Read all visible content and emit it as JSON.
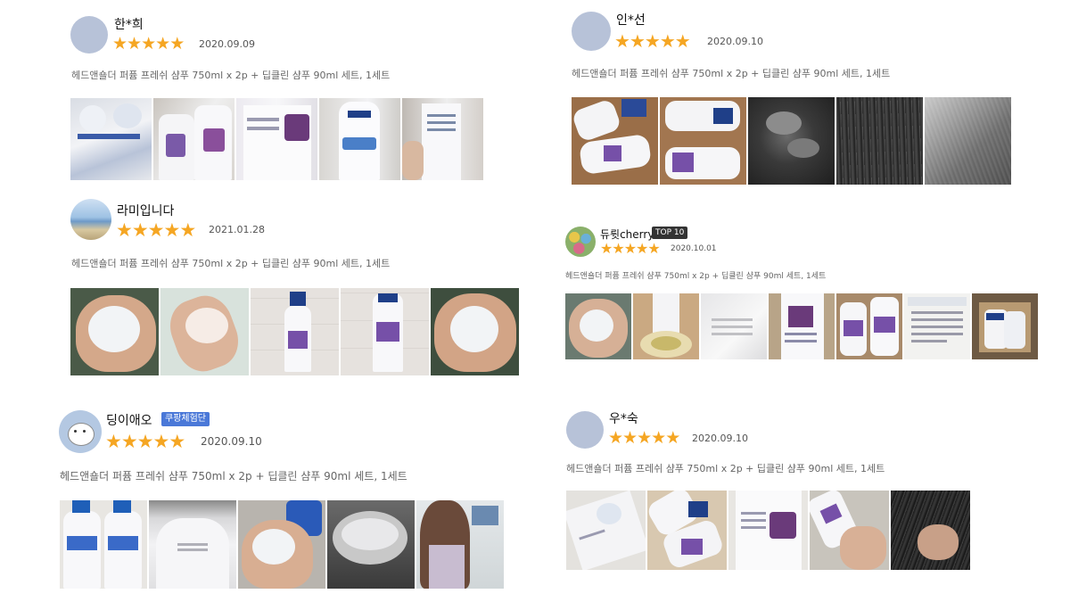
{
  "product_line": "헤드앤숄더 퍼퓸 프레쉬 샴푸 750ml x 2p + 딥클린 샴푸 90ml 세트, 1세트",
  "star_glyph": "★",
  "colors": {
    "star": "#f5a623",
    "top10_badge": "#333333",
    "experience_badge": "#4a78d8"
  },
  "reviews": [
    {
      "name": "한*희",
      "date": "2020.09.09",
      "rating": 5,
      "avatar": "placeholder",
      "photo_count": 5
    },
    {
      "name": "인*선",
      "date": "2020.09.10",
      "rating": 5,
      "avatar": "placeholder",
      "photo_count": 5
    },
    {
      "name": "라미입니다",
      "date": "2021.01.28",
      "rating": 5,
      "avatar": "landscape-photo",
      "photo_count": 5
    },
    {
      "name": "듀륏cherry",
      "badge": "TOP 10",
      "date": "2020.10.01",
      "rating": 5,
      "avatar": "colorful-photo",
      "photo_count": 7
    },
    {
      "name": "딩이애오",
      "badge": "쿠팡체험단",
      "date": "2020.09.10",
      "rating": 5,
      "avatar": "cartoon-character",
      "photo_count": 5
    },
    {
      "name": "우*숙",
      "date": "2020.09.10",
      "rating": 5,
      "avatar": "placeholder",
      "photo_count": 5
    }
  ]
}
